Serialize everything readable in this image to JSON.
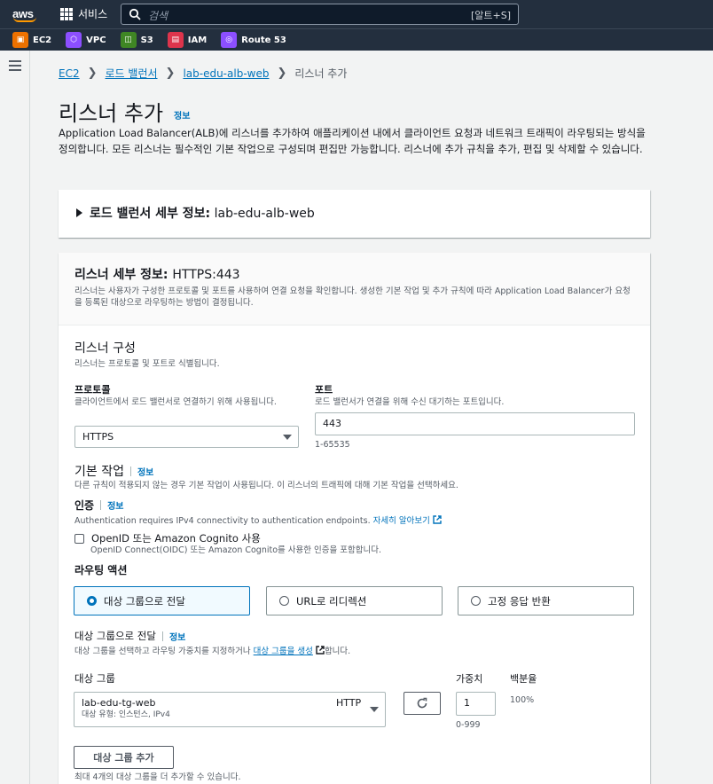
{
  "topnav": {
    "logo": "aws",
    "services_label": "서비스",
    "search_placeholder": "검색",
    "search_shortcut": "[알트+S]"
  },
  "favorites": [
    {
      "label": "EC2",
      "icon": "ec2-icon",
      "color": "#ed7100"
    },
    {
      "label": "VPC",
      "icon": "vpc-icon",
      "color": "#8c4fff"
    },
    {
      "label": "S3",
      "icon": "s3-icon",
      "color": "#3f8624"
    },
    {
      "label": "IAM",
      "icon": "iam-icon",
      "color": "#dd344c"
    },
    {
      "label": "Route 53",
      "icon": "route53-icon",
      "color": "#8c4fff"
    }
  ],
  "breadcrumb": {
    "items": [
      "EC2",
      "로드 밸런서",
      "lab-edu-alb-web"
    ],
    "current": "리스너 추가"
  },
  "page": {
    "title": "리스너 추가",
    "info": "정보",
    "description": "Application Load Balancer(ALB)에 리스너를 추가하여 애플리케이션 내에서 클라이언트 요청과 네트워크 트래픽이 라우팅되는 방식을 정의합니다. 모든 리스너는 필수적인 기본 작업으로 구성되며 편집만 가능합니다. 리스너에 추가 규칙을 추가, 편집 및 삭제할 수 있습니다."
  },
  "lb_details": {
    "label": "로드 밸런서 세부 정보:",
    "value": "lab-edu-alb-web"
  },
  "listener_details": {
    "label": "리스너 세부 정보:",
    "value": "HTTPS:443",
    "description": "리스너는 사용자가 구성한 프로토콜 및 포트를 사용하여 연결 요청을 확인합니다. 생성한 기본 작업 및 추가 규칙에 따라 Application Load Balancer가 요청을 등록된 대상으로 라우팅하는 방법이 결정됩니다."
  },
  "listener_config": {
    "title": "리스너 구성",
    "description": "리스너는 프로토콜 및 포트로 식별됩니다.",
    "protocol_label": "프로토콜",
    "protocol_desc": "클라이언트에서 로드 밸런서로 연결하기 위해 사용됩니다.",
    "protocol_value": "HTTPS",
    "port_label": "포트",
    "port_desc": "로드 밸런서가 연결을 위해 수신 대기하는 포트입니다.",
    "port_value": "443",
    "port_constraint": "1-65535"
  },
  "default_action": {
    "title": "기본 작업",
    "info": "정보",
    "description": "다른 규칙이 적용되지 않는 경우 기본 작업이 사용됩니다. 이 리스너의 트래픽에 대해 기본 작업을 선택하세요."
  },
  "auth": {
    "title": "인증",
    "info": "정보",
    "description": "Authentication requires IPv4 connectivity to authentication endpoints.",
    "learn_more": "자세히 알아보기",
    "checkbox_label": "OpenID 또는 Amazon Cognito 사용",
    "checkbox_desc": "OpenID Connect(OIDC) 또는 Amazon Cognito를 사용한 인증을 포함합니다.",
    "checked": false
  },
  "routing": {
    "title": "라우팅 액션",
    "options": [
      "대상 그룹으로 전달",
      "URL로 리디렉션",
      "고정 응답 반환"
    ],
    "selected": 0
  },
  "forward": {
    "title": "대상 그룹으로 전달",
    "info": "정보",
    "desc_before": "대상 그룹을 선택하고 라우팅 가중치를 지정하거나",
    "create_link": "대상 그룹을 생성",
    "desc_after": "합니다.",
    "tg_label": "대상 그룹",
    "weight_label": "가중치",
    "percent_label": "백분율",
    "tg_name": "lab-edu-tg-web",
    "tg_protocol": "HTTP",
    "tg_subtitle": "대상 유형: 인스턴스, IPv4",
    "weight_value": "1",
    "weight_constraint": "0-999",
    "percent_value": "100%",
    "add_button": "대상 그룹 추가",
    "add_hint": "최대 4개의 대상 그룹을 더 추가할 수 있습니다."
  }
}
